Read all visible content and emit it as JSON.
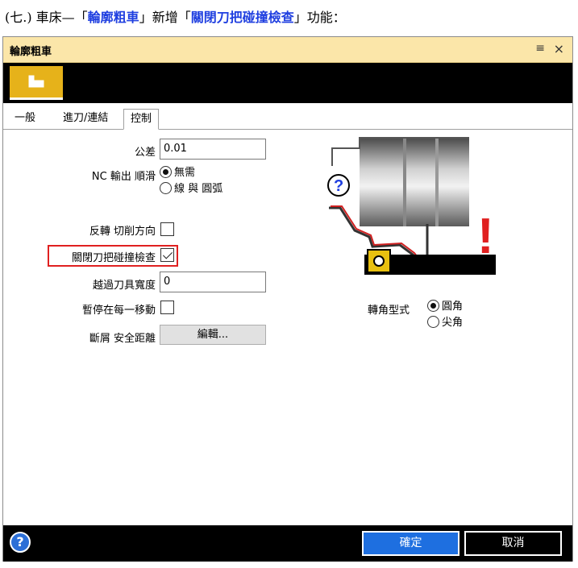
{
  "heading": {
    "prefix": "(七.) 車床—「",
    "highlight1": "輪廓粗車",
    "middle": "」新增「",
    "highlight2": "關閉刀把碰撞檢查",
    "suffix": "」功能："
  },
  "dialog": {
    "title": "輪廓粗車",
    "pin_icon": "pin-icon",
    "close_label": "×"
  },
  "tabs": [
    "一般",
    "進刀/連結",
    "控制"
  ],
  "active_tab": "控制",
  "form": {
    "tolerance": {
      "label": "公差",
      "value": "0.01"
    },
    "nc_smooth": {
      "label": "NC 輸出 順滑",
      "options": [
        "無需",
        "線 與 圓弧"
      ],
      "selected": "無需"
    },
    "reverse_cut": {
      "label": "反轉 切削方向",
      "checked": false
    },
    "disable_holder_collision": {
      "label": "關閉刀把碰撞檢查",
      "checked": true
    },
    "exceed_tool_width": {
      "label": "越過刀具寬度",
      "value": "0"
    },
    "pause_each_move": {
      "label": "暫停在每一移動",
      "checked": false
    },
    "chip_break_clearance": {
      "label": "斷屑 安全距離",
      "button": "編輯..."
    }
  },
  "corner": {
    "label": "轉角型式",
    "options": [
      "圓角",
      "尖角"
    ],
    "selected": "圓角"
  },
  "illustration": {
    "question_mark": "?",
    "exclamation": "!"
  },
  "footer": {
    "help": "?",
    "ok": "確定",
    "cancel": "取消"
  },
  "colors": {
    "title_bar": "#fbe6a9",
    "mode_button": "#e6b21a",
    "ok_button": "#1e6fe0",
    "highlight_text": "#1f3fe0",
    "annotation_box": "#e02020"
  }
}
